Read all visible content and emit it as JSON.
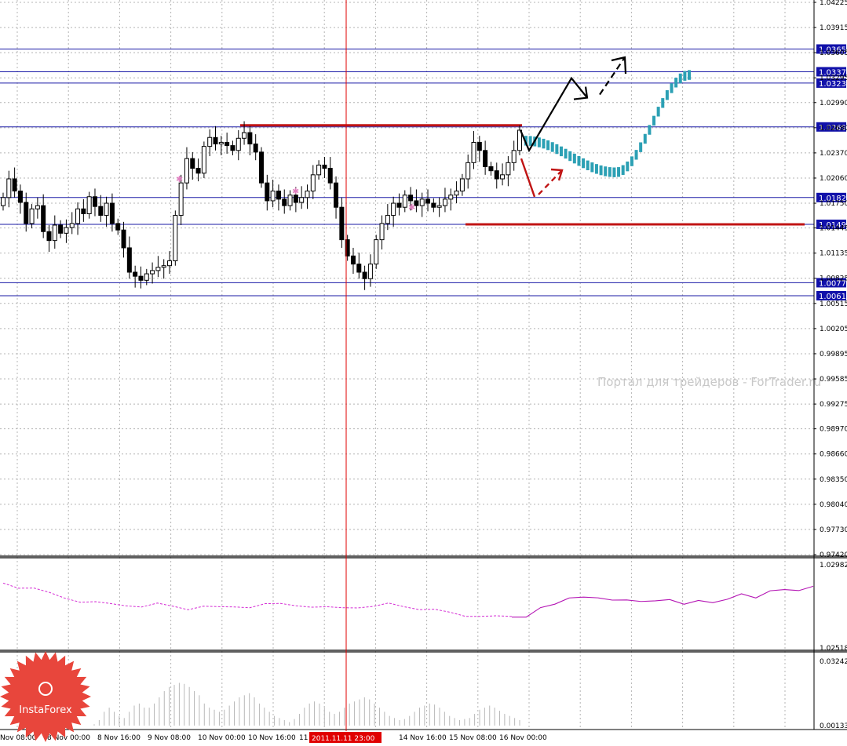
{
  "chart_data": [
    {
      "type": "candlestick",
      "panel": "price",
      "y_ticks": [
        "1.04225",
        "1.03915",
        "1.03605",
        "1.03295",
        "1.02990",
        "1.02680",
        "1.02370",
        "1.02060",
        "1.01750",
        "1.01445",
        "1.01135",
        "1.00825",
        "1.00515",
        "1.00205",
        "0.99895",
        "0.99585",
        "0.99275",
        "0.98970",
        "0.98660",
        "0.98350",
        "0.98040",
        "0.97730",
        "0.97420"
      ],
      "ylim": [
        0.9742,
        1.04225
      ],
      "horizontal_levels": [
        "1.0365",
        "1.0337",
        "1.0323",
        "1.0269",
        "1.0182",
        "1.0149",
        "1.0077",
        "1.0061"
      ],
      "resistance_line": 1.0271,
      "support_line": 1.0149,
      "x_labels": [
        "Nov 08:00",
        "8 Nov 00:00",
        "8 Nov 16:00",
        "9 Nov 08:00",
        "10 Nov 00:00",
        "10 Nov 16:00",
        "11",
        "2011.11.11 23:00",
        "14 Nov 16:00",
        "15 Nov 08:00",
        "16 Nov 00:00"
      ],
      "cursor_label": "2011.11.11 23:00",
      "closes": [
        1.0182,
        1.0205,
        1.019,
        1.0176,
        1.015,
        1.0168,
        1.0172,
        1.014,
        1.0129,
        1.0148,
        1.0138,
        1.0145,
        1.015,
        1.0168,
        1.0162,
        1.0183,
        1.0171,
        1.016,
        1.0175,
        1.015,
        1.0142,
        1.012,
        1.009,
        1.0085,
        1.008,
        1.0088,
        1.0092,
        1.0096,
        1.0098,
        1.0104,
        1.016,
        1.02,
        1.023,
        1.0218,
        1.0212,
        1.0245,
        1.0256,
        1.0248,
        1.025,
        1.0246,
        1.024,
        1.0255,
        1.0262,
        1.0248,
        1.0238,
        1.02,
        1.0178,
        1.019,
        1.018,
        1.0172,
        1.0185,
        1.0176,
        1.0182,
        1.019,
        1.021,
        1.0222,
        1.0218,
        1.02,
        1.017,
        1.013,
        1.011,
        1.01,
        1.009,
        1.0082,
        1.01,
        1.013,
        1.015,
        1.016,
        1.0175,
        1.017,
        1.0185,
        1.0178,
        1.0172,
        1.018,
        1.0175,
        1.017,
        1.0172,
        1.018,
        1.0185,
        1.019,
        1.0205,
        1.0225,
        1.025,
        1.024,
        1.022,
        1.0215,
        1.0205,
        1.021,
        1.0225,
        1.024,
        1.0265
      ],
      "forecast": {
        "black_arrow_path": [
          "1.0240",
          "1.0329",
          "1.0305"
        ],
        "red_arrow_path": [
          "1.0230",
          "1.0207"
        ],
        "blue_bars_start": 1.0252,
        "blue_bars_low": 1.0213,
        "blue_bars_end": 1.0333
      },
      "watermark": "Портал для трейдеров - ForTrader.ru"
    },
    {
      "type": "line",
      "panel": "indicator-1",
      "y_ticks": [
        "1.02982",
        "1.02518"
      ],
      "ylim": [
        1.02518,
        1.02982
      ],
      "series": [
        {
          "style": "dashed",
          "color": "#d42bd4",
          "values": [
            1.0288,
            1.0286,
            1.0285,
            1.0282,
            1.028,
            1.0278,
            1.0277,
            1.0276,
            1.0276,
            1.0275,
            1.0276,
            1.0275,
            1.0274,
            1.0275,
            1.0274,
            1.0275,
            1.0275,
            1.0276,
            1.0276,
            1.0276,
            1.0275,
            1.0274,
            1.0274,
            1.0275,
            1.0275,
            1.0276,
            1.0275,
            1.0274,
            1.0273,
            1.0271,
            1.027,
            1.027,
            1.0269,
            1.0269
          ]
        },
        {
          "style": "solid",
          "color": "#b414b4",
          "values": [
            1.0269,
            1.027,
            1.0273,
            1.0277,
            1.028,
            1.0279,
            1.0281,
            1.0278,
            1.0278,
            1.0279,
            1.0277,
            1.0279,
            1.0277,
            1.0277,
            1.0278,
            1.0279,
            1.0281,
            1.0281,
            1.0283,
            1.0284,
            1.0285,
            1.0285
          ]
        }
      ]
    },
    {
      "type": "bar",
      "panel": "indicator-2",
      "y_ticks": [
        "0.03242",
        "0.00133"
      ],
      "ylim": [
        0.00133,
        0.03242
      ],
      "values": [
        0.002,
        0.004,
        0.008,
        0.01,
        0.008,
        0.006,
        0.005,
        0.008,
        0.011,
        0.012,
        0.01,
        0.01,
        0.012,
        0.015,
        0.018,
        0.02,
        0.021,
        0.022,
        0.0215,
        0.02,
        0.018,
        0.016,
        0.012,
        0.01,
        0.009,
        0.008,
        0.009,
        0.011,
        0.013,
        0.015,
        0.016,
        0.017,
        0.015,
        0.012,
        0.01,
        0.008,
        0.006,
        0.005,
        0.004,
        0.003,
        0.0045,
        0.007,
        0.01,
        0.012,
        0.013,
        0.012,
        0.01,
        0.008,
        0.007,
        0.008,
        0.01,
        0.012,
        0.013,
        0.014,
        0.015,
        0.014,
        0.012,
        0.01,
        0.008,
        0.006,
        0.005,
        0.004,
        0.0045,
        0.006,
        0.008,
        0.01,
        0.011,
        0.012,
        0.0115,
        0.01,
        0.008,
        0.006,
        0.005,
        0.004,
        0.0045,
        0.005,
        0.007,
        0.009,
        0.01,
        0.011,
        0.01,
        0.0085,
        0.007,
        0.006,
        0.005,
        0.004
      ]
    }
  ],
  "logo": {
    "text": "InstaForex"
  },
  "colors": {
    "level_line": "#1a1aa6",
    "level_label_bg": "#1111aa",
    "red_level": "#c01414",
    "cursor": "#e00000",
    "forecast_bars": "#2ca0b4",
    "grid": "#b4b4b4",
    "logo": "#e8463c"
  }
}
